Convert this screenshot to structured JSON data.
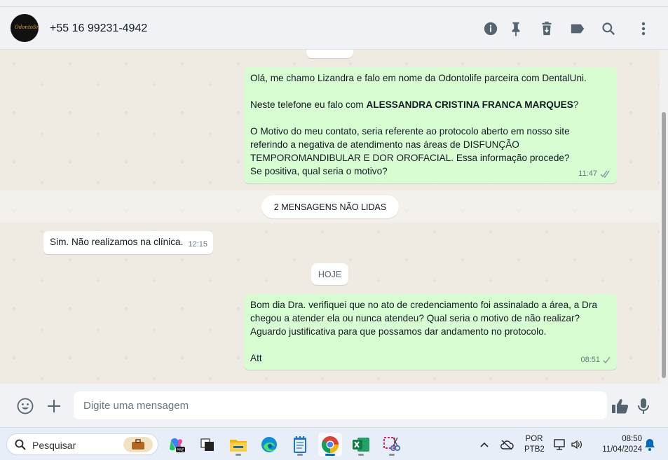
{
  "header": {
    "contact_name": "+55 16 99231-4942",
    "avatar_logo_text": "OdontoSmile",
    "icons": [
      "info-icon",
      "pin-icon",
      "delete-icon",
      "label-icon",
      "search-icon",
      "menu-icon"
    ]
  },
  "messages": {
    "m1": {
      "line1": "Olá, me chamo Lizandra e falo em nome da Odontolife parceira com DentalUni.",
      "line2_pre": "Neste telefone eu falo com ",
      "line2_bold": "ALESSANDRA CRISTINA FRANCA MARQUES",
      "line2_post": "?",
      "line3": "O Motivo do meu contato, seria referente ao protocolo aberto em nosso site referindo a negativa de atendimento nas áreas de DISFUNÇÃO TEMPOROMANDIBULAR E DOR OROFACIAL. Essa informação procede? Se positiva, qual seria o motivo?",
      "time": "11:47"
    },
    "unread_label": "2 MENSAGENS NÃO LIDAS",
    "m2": {
      "text": "Sim. Não realizamos na clínica.",
      "time": "12:15"
    },
    "day_label": "HOJE",
    "m3": {
      "text": "Bom dia Dra. verifiquei que no ato de credenciamento foi assinalado a área, a Dra chegou a atender ela ou nunca atendeu? Qual seria o motivo de não realizar? Aguardo justificativa para que possamos dar andamento no protocolo.",
      "sign": "Att",
      "time": "08:51"
    }
  },
  "composer": {
    "placeholder": "Digite uma mensagem"
  },
  "taskbar": {
    "search_label": "Pesquisar",
    "language_line1": "POR",
    "language_line2": "PTB2",
    "time": "08:50",
    "date": "11/04/2024"
  },
  "colors": {
    "outgoing_bubble": "#d9fdd3",
    "incoming_bubble": "#ffffff",
    "chat_background": "#efeae2",
    "read_tick": "#53bdeb"
  }
}
